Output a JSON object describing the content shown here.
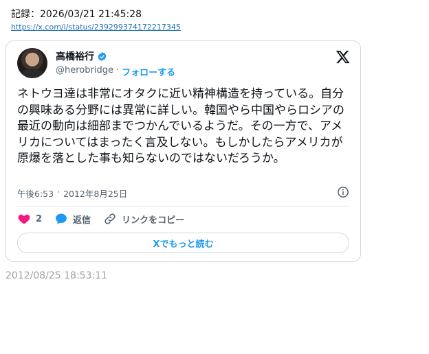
{
  "record": "記録：2026/03/21 21:45:28",
  "link": "https://x.com/i/status/239299374172217345",
  "card": {
    "author_name": "高橋裕行",
    "handle": "@herobridge",
    "separator": "·",
    "follow_label": "フォローする",
    "text": "ネトウヨ達は非常にオタクに近い精神構造を持っている。自分の興味ある分野には異常に詳しい。韓国やら中国やらロシアの最近の動向は細部までつかんでいるようだ。その一方で、アメリカについてはまったく言及しない。もしかしたらアメリカが原爆を落とした事も知らないのではないだろうか。",
    "time": "午後6:53",
    "date_sep": "·",
    "date": "2012年8月25日",
    "like_count": "2",
    "reply_label": "返信",
    "copy_link_label": "リンクをコピー",
    "read_more_label": "Xでもっと読む",
    "icons": [
      "verified-icon",
      "x-logo-icon",
      "info-icon",
      "heart-icon",
      "reply-icon",
      "link-icon"
    ],
    "colors": {
      "accent": "#1d9bf0",
      "like": "#f91880",
      "muted": "#536471"
    }
  },
  "footer_date": "2012/08/25 18:53:11"
}
